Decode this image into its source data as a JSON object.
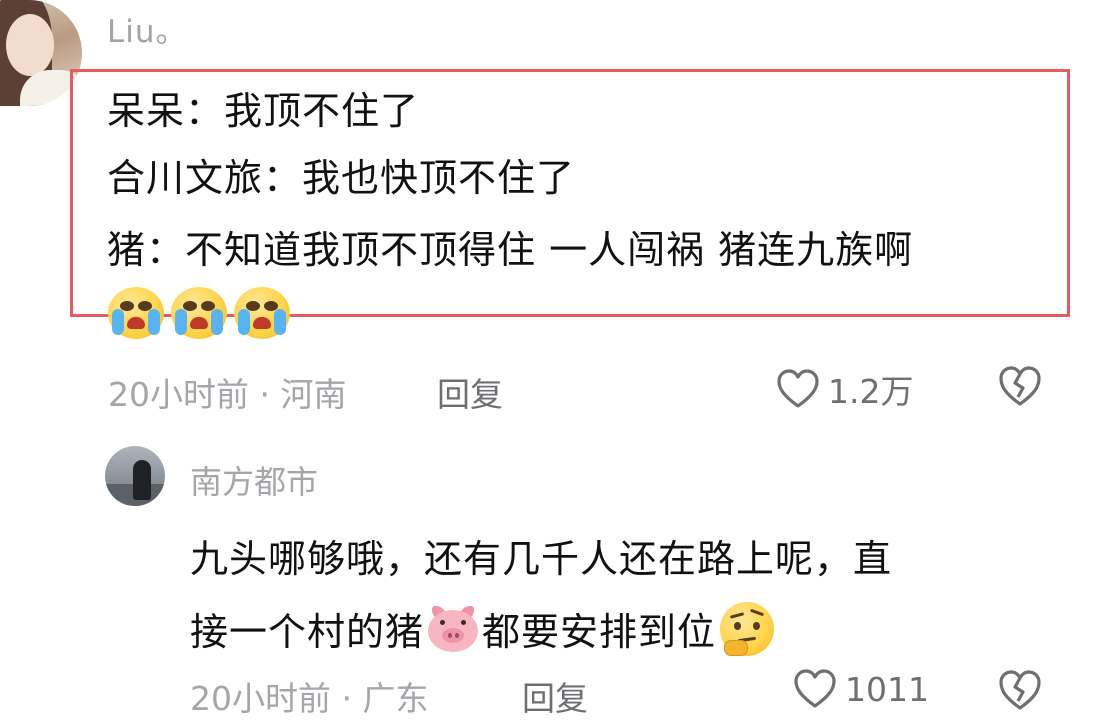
{
  "comments": [
    {
      "username": "Liu。",
      "lines": [
        "呆呆：我顶不住了",
        "合川文旅：我也快顶不住了",
        "猪：不知道我顶不顶得住 一人闯祸 猪连九族啊"
      ],
      "emojis": [
        "crying-face-emoji",
        "crying-face-emoji",
        "crying-face-emoji"
      ],
      "meta": "20小时前 · 河南",
      "reply_label": "回复",
      "like_count": "1.2万"
    },
    {
      "username": "南方都市",
      "lines": [
        "九头哪够哦，还有几千人还在路上呢，直",
        "接一个村的猪",
        "都要安排到位"
      ],
      "emojis": [
        "pig-face-emoji",
        "thinking-face-emoji"
      ],
      "meta": "20小时前 · 广东",
      "reply_label": "回复",
      "like_count": "1011"
    }
  ],
  "icons": {
    "like": "heart-outline-icon",
    "dislike": "broken-heart-icon"
  },
  "colors": {
    "highlight_border": "#e95b5e",
    "meta_text": "#a5a5aa",
    "body_text": "#111111"
  }
}
